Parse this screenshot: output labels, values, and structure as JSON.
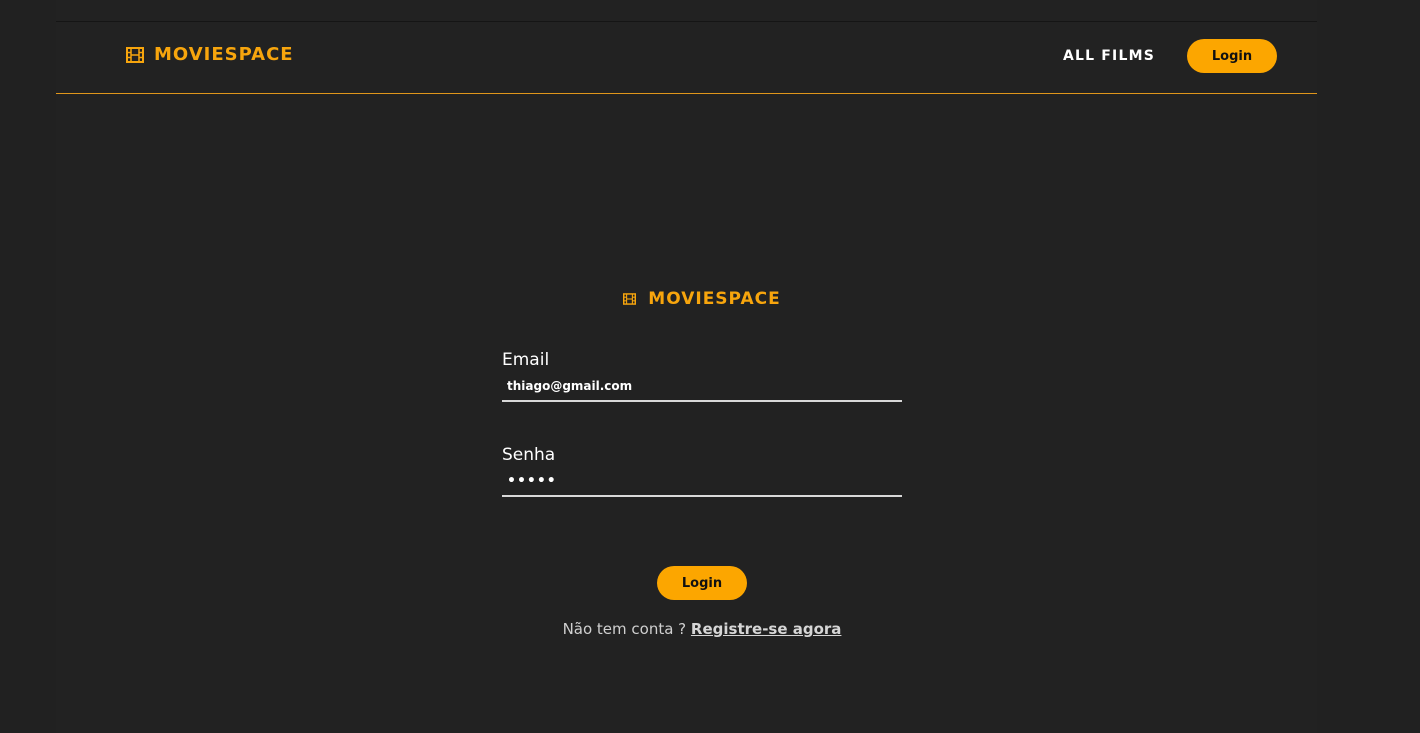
{
  "brand": {
    "name": "MOVIESPACE",
    "icon": "film-icon",
    "color": "#f7a50d"
  },
  "nav": {
    "all_films": "ALL FILMS",
    "login_label": "Login"
  },
  "form": {
    "brand_name": "MOVIESPACE",
    "email_label": "Email",
    "email_value": "thiago@gmail.com",
    "password_label": "Senha",
    "password_value": "•••••",
    "submit_label": "Login",
    "no_account_text": "Não tem conta ? ",
    "register_link": "Registre-se agora"
  },
  "colors": {
    "accent": "#fca600",
    "background": "#212121"
  }
}
